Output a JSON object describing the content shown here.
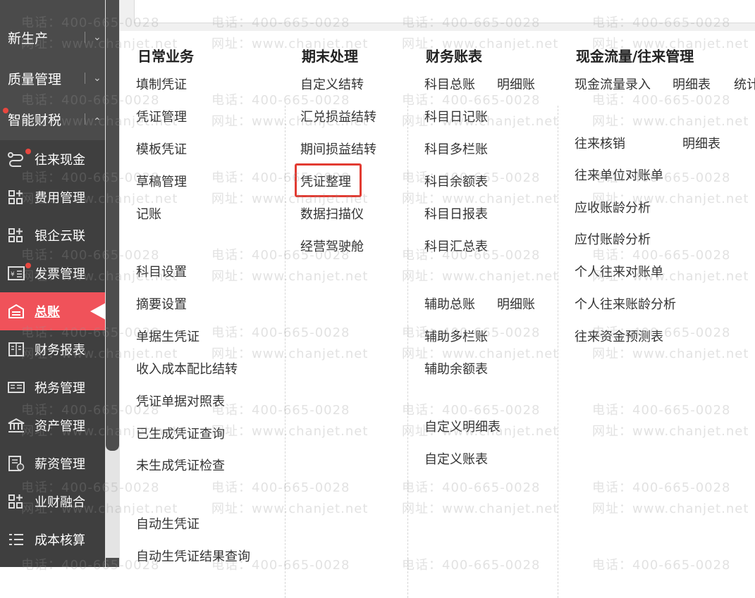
{
  "sidebar": {
    "top_items": [
      {
        "label": "新生产"
      },
      {
        "label": "质量管理"
      },
      {
        "label": "智能财税"
      }
    ],
    "sub_items": [
      {
        "label": "往来现金",
        "icon": "route-icon"
      },
      {
        "label": "费用管理",
        "icon": "grid-plus-icon"
      },
      {
        "label": "银企云联",
        "icon": "grid-plus-icon"
      },
      {
        "label": "发票管理",
        "icon": "invoice-icon"
      },
      {
        "label": "总账",
        "icon": "ledger-icon"
      },
      {
        "label": "财务报表",
        "icon": "book-icon"
      },
      {
        "label": "税务管理",
        "icon": "tax-icon"
      },
      {
        "label": "资产管理",
        "icon": "bank-icon"
      },
      {
        "label": "薪资管理",
        "icon": "payroll-icon"
      },
      {
        "label": "业财融合",
        "icon": "grid-plus-icon"
      },
      {
        "label": "成本核算",
        "icon": "list-check-icon"
      }
    ],
    "accent_color": "#f0525a"
  },
  "menu": {
    "daily": {
      "title": "日常业务",
      "items": [
        "填制凭证",
        "凭证管理",
        "模板凭证",
        "草稿管理",
        "记账",
        "科目设置",
        "摘要设置",
        "单据生凭证",
        "收入成本配比结转",
        "凭证单据对照表",
        "已生成凭证查询",
        "未生成凭证检查",
        "自动生凭证",
        "自动生凭证结果查询"
      ]
    },
    "period_end": {
      "title": "期末处理",
      "items": [
        "自定义结转",
        "汇兑损益结转",
        "期间损益结转",
        "凭证整理",
        "数据扫描仪",
        "经营驾驶舱"
      ]
    },
    "ledgers": {
      "title": "财务账表",
      "items": [
        "科目总账",
        "明细账",
        "科目日记账",
        "科目多栏账",
        "科目余额表",
        "科目日报表",
        "科目汇总表",
        "辅助总账",
        "明细账",
        "辅助多栏账",
        "辅助余额表",
        "自定义明细表",
        "自定义账表"
      ]
    },
    "cashflow": {
      "title": "现金流量/往来管理",
      "items": [
        "现金流量录入",
        "明细表",
        "统计",
        "往来核销",
        "明细表",
        "往来单位对账单",
        "应收账龄分析",
        "应付账龄分析",
        "个人往来对账单",
        "个人往来账龄分析",
        "往来资金预测表"
      ]
    }
  },
  "watermark": {
    "phone": "电话：400-665-0028",
    "site": "网址：www.chanjet.net"
  }
}
